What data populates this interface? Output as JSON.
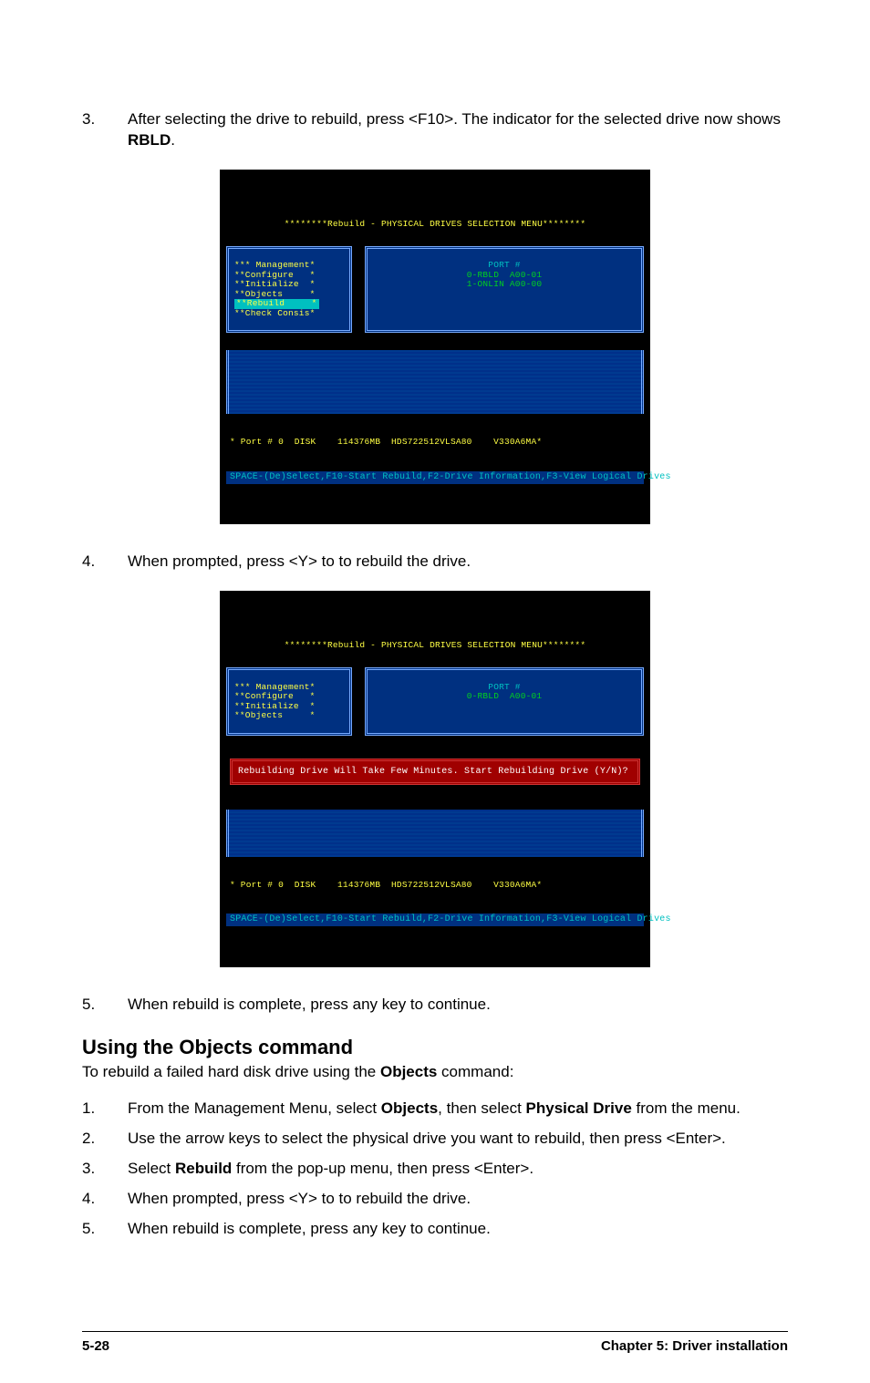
{
  "step3": {
    "num": "3.",
    "text_before": "After selecting the drive to rebuild, press <F10>. The indicator for the selected drive now shows ",
    "rbld": "RBLD",
    "period": "."
  },
  "shot1": {
    "title": "********Rebuild - PHYSICAL DRIVES SELECTION MENU********",
    "menu": {
      "head": "*** Management*",
      "items": [
        "**Configure   *",
        "**Initialize  *",
        "**Objects     *",
        "**Rebuild     *",
        "**Check Consis*"
      ]
    },
    "panel": {
      "head": "PORT #",
      "line1": "0-RBLD  A00-01",
      "line2": "1-ONLIN A00-00"
    },
    "status": "* Port # 0  DISK    114376MB  HDS722512VLSA80    V330A6MA*",
    "foot": "SPACE-(De)Select,F10-Start Rebuild,F2-Drive Information,F3-View Logical Drives"
  },
  "step4": {
    "num": "4.",
    "text": "When prompted, press <Y> to to rebuild the drive."
  },
  "shot2": {
    "title": "********Rebuild - PHYSICAL DRIVES SELECTION MENU********",
    "menu": {
      "head": "*** Management*",
      "items": [
        "**Configure   *",
        "**Initialize  *",
        "**Objects     *"
      ]
    },
    "panel": {
      "head": "PORT #",
      "line1": "0-RBLD  A00-01"
    },
    "banner": "Rebuilding Drive Will Take Few Minutes. Start Rebuilding Drive (Y/N)?",
    "status": "* Port # 0  DISK    114376MB  HDS722512VLSA80    V330A6MA*",
    "foot": "SPACE-(De)Select,F10-Start Rebuild,F2-Drive Information,F3-View Logical Drives"
  },
  "step5": {
    "num": "5.",
    "text": "When rebuild is complete, press any key to continue."
  },
  "section": {
    "heading": "Using the Objects command",
    "intro_before": "To rebuild a failed hard disk drive using the ",
    "intro_bold": "Objects",
    "intro_after": " command:"
  },
  "list2": {
    "s1": {
      "num": "1.",
      "a": "From the Management Menu, select ",
      "b1": "Objects",
      "c": ", then select ",
      "b2": "Physical Drive",
      "d": " from the menu."
    },
    "s2": {
      "num": "2.",
      "text": "Use the arrow keys to select the physical drive you want to rebuild, then press <Enter>."
    },
    "s3": {
      "num": "3.",
      "a": "Select ",
      "b": "Rebuild",
      "c": " from the pop-up menu, then press <Enter>."
    },
    "s4": {
      "num": "4.",
      "text": "When prompted, press <Y> to to rebuild the drive."
    },
    "s5": {
      "num": "5.",
      "text": "When rebuild is complete, press any key to continue."
    }
  },
  "footer": {
    "left": "5-28",
    "right": "Chapter 5: Driver installation"
  }
}
